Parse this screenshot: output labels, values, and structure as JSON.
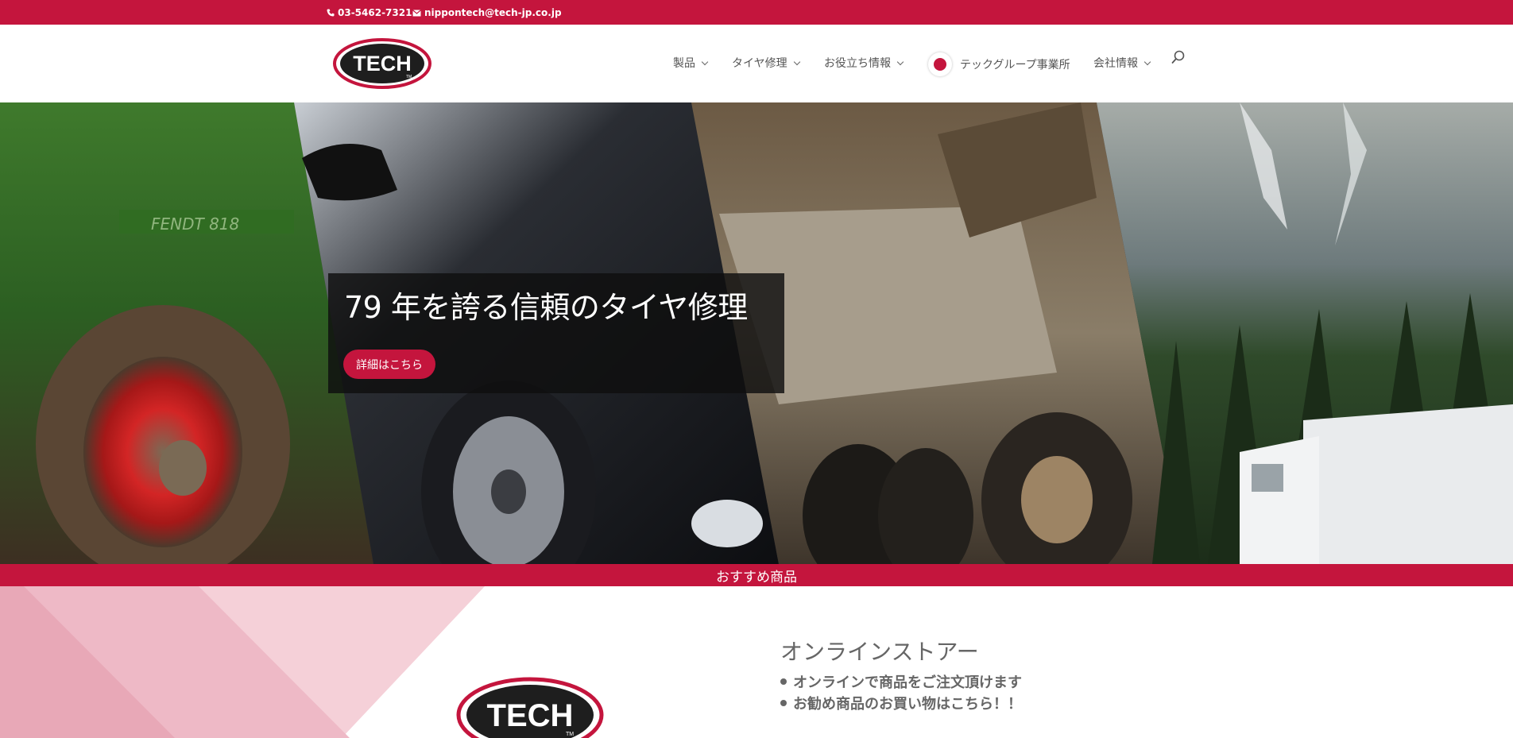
{
  "colors": {
    "brand": "#c4153d",
    "text": "#666666"
  },
  "topbar": {
    "phone": "03-5462-7321",
    "phone_icon": "phone-icon",
    "email": "nippontech@tech-jp.co.jp",
    "email_icon": "mail-icon"
  },
  "header": {
    "logo_text": "TECH",
    "logo_tm": "TM",
    "nav": [
      {
        "label": "製品",
        "has_dropdown": true
      },
      {
        "label": "タイヤ修理",
        "has_dropdown": true
      },
      {
        "label": "お役立ち情報",
        "has_dropdown": true
      },
      {
        "label": "テックグループ事業所",
        "has_dropdown": false,
        "icon": "japan-flag-icon"
      },
      {
        "label": "会社情報",
        "has_dropdown": true
      }
    ],
    "search_icon": "search-icon"
  },
  "hero": {
    "title": "79 年を誇る信頼のタイヤ修理",
    "button_label": "詳細はこちら"
  },
  "band": {
    "label": "おすすめ商品"
  },
  "store": {
    "title": "オンラインストアー",
    "items": [
      "オンラインで商品をご注文頂けます",
      "お勧め商品のお買い物はこちら！！"
    ]
  }
}
